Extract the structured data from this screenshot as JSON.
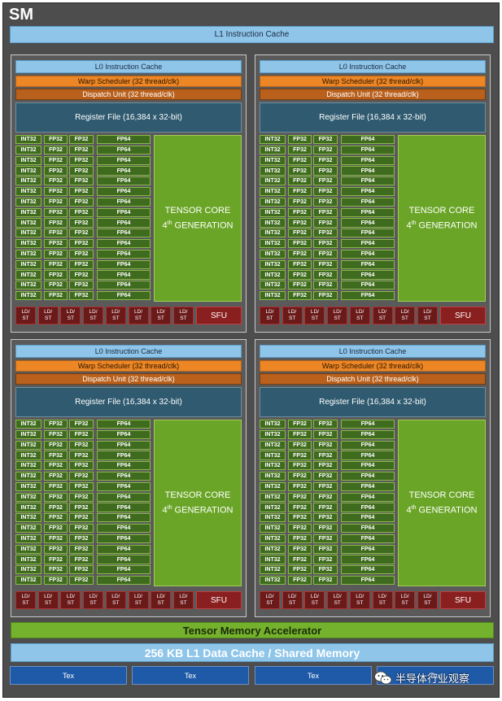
{
  "sm_title": "SM",
  "l1_instruction_cache": "L1 Instruction Cache",
  "partition": {
    "l0_cache": "L0 Instruction Cache",
    "warp_scheduler": "Warp Scheduler (32 thread/clk)",
    "dispatch_unit": "Dispatch Unit (32 thread/clk)",
    "register_file": "Register File (16,384 x 32-bit)",
    "int32": "INT32",
    "fp32": "FP32",
    "fp64": "FP64",
    "tensor_line1": "TENSOR CORE",
    "tensor_4": "4",
    "tensor_th": "th",
    "tensor_gen": "GENERATION",
    "ld": "LD/",
    "st": "ST",
    "sfu": "SFU"
  },
  "partition_count": 4,
  "core_rows": 16,
  "ldst_units": 8,
  "tensor_memory_accelerator": "Tensor Memory Accelerator",
  "l1_data_cache": "256 KB L1 Data Cache / Shared Memory",
  "tex_units": [
    "Tex",
    "Tex",
    "Tex",
    "Tex"
  ],
  "watermark": "半导体行业观察",
  "colors": {
    "background": "#4d4d4d",
    "cache": "#8ec5e8",
    "warp": "#ed8624",
    "dispatch": "#b8601c",
    "register": "#2f5a6f",
    "core": "#3f6b1f",
    "tensor": "#6aa527",
    "ldst": "#6b1a1a",
    "tex": "#1f5aa8"
  }
}
